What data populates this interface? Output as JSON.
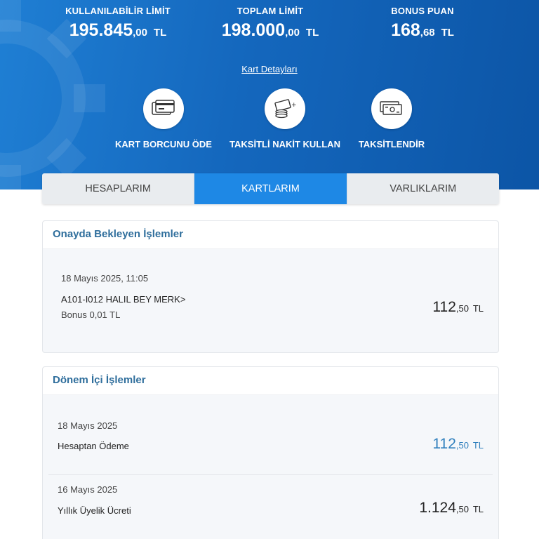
{
  "summary": {
    "available_limit": {
      "label": "KULLANILABİLİR LİMİT",
      "int": "195.845",
      "dec": ",00",
      "currency": "TL"
    },
    "total_limit": {
      "label": "TOPLAM LİMİT",
      "int": "198.000",
      "dec": ",00",
      "currency": "TL"
    },
    "bonus_points": {
      "label": "BONUS PUAN",
      "int": "168",
      "dec": ",68",
      "currency": "TL"
    },
    "card_details_link": "Kart Detayları"
  },
  "actions": [
    {
      "label": "KART BORCUNU ÖDE",
      "icon": "card-pay-icon"
    },
    {
      "label": "TAKSİTLİ NAKİT KULLAN",
      "icon": "cash-coins-icon"
    },
    {
      "label": "TAKSİTLENDİR",
      "icon": "banknotes-icon"
    }
  ],
  "tabs": [
    {
      "label": "HESAPLARIM",
      "active": false
    },
    {
      "label": "KARTLARIM",
      "active": true
    },
    {
      "label": "VARLIKLARIM",
      "active": false
    }
  ],
  "pending": {
    "title": "Onayda Bekleyen İşlemler",
    "items": [
      {
        "date": "18 Mayıs 2025, 11:05",
        "description": "A101-I012 HALIL BEY MERK>",
        "bonus": "Bonus 0,01 TL",
        "amount_int": "112",
        "amount_dec": ",50",
        "currency": "TL"
      }
    ]
  },
  "period": {
    "title": "Dönem İçi İşlemler",
    "items": [
      {
        "date": "18 Mayıs 2025",
        "description": "Hesaptan Ödeme",
        "amount_int": "112",
        "amount_dec": ",50",
        "currency": "TL",
        "color": "#2f7fbd"
      },
      {
        "date": "16 Mayıs 2025",
        "description": "Yıllık Üyelik Ücreti",
        "amount_int": "1.124",
        "amount_dec": ",50",
        "currency": "TL",
        "color": "#222222"
      }
    ]
  },
  "colors": {
    "header_blue": "#1467bd",
    "tab_active": "#1e88e5",
    "title_blue": "#2f6e9c"
  }
}
